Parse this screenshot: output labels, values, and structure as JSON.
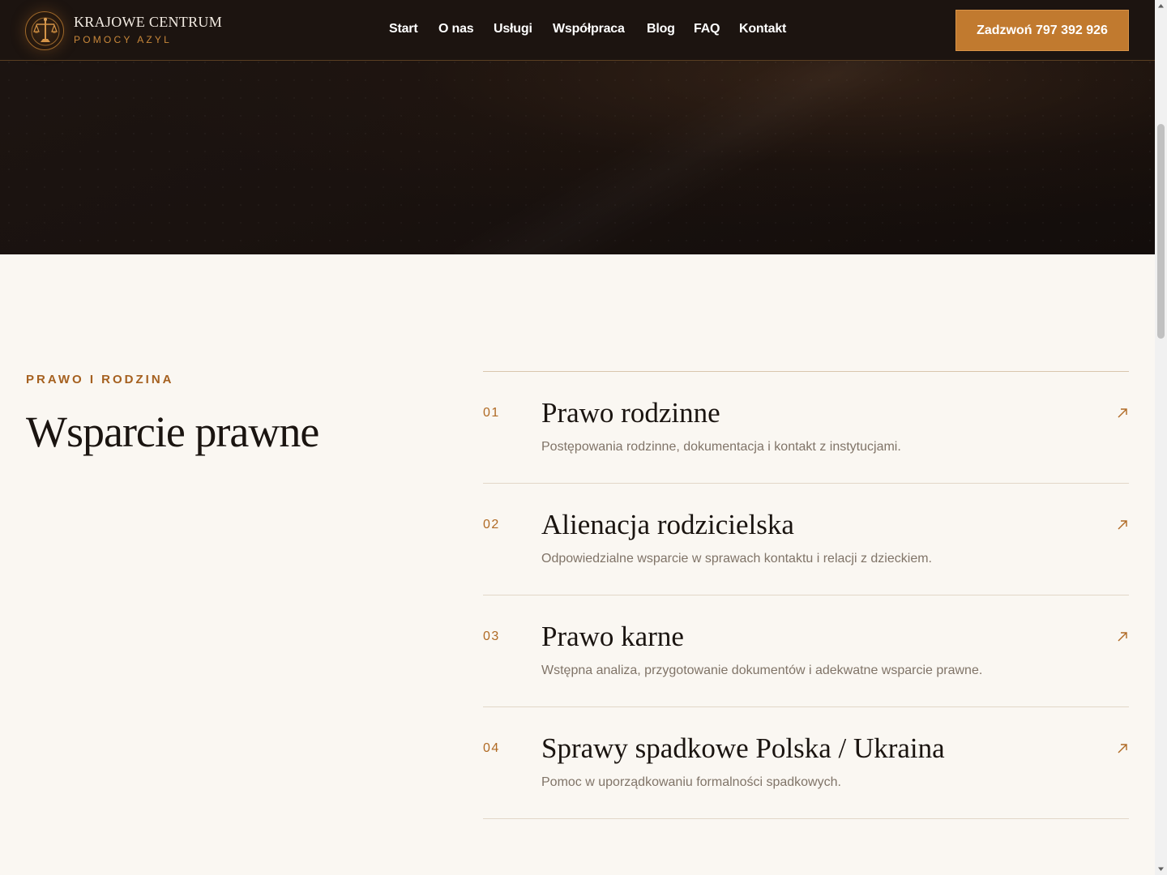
{
  "brand": {
    "title": "KRAJOWE CENTRUM",
    "subtitle": "POMOCY AZYL",
    "logo_icon": "scales-of-justice-emblem-icon",
    "accent_color": "#c17a2f"
  },
  "nav": {
    "items": [
      {
        "label": "Start"
      },
      {
        "label": "O nas"
      },
      {
        "label": "Usługi"
      },
      {
        "label": "Współpraca"
      },
      {
        "label": "Blog"
      },
      {
        "label": "FAQ"
      },
      {
        "label": "Kontakt"
      }
    ]
  },
  "cta": {
    "label": "Zadzwoń 797 392 926"
  },
  "section": {
    "eyebrow": "PRAWO I RODZINA",
    "title": "Wsparcie prawne",
    "items": [
      {
        "number": "01",
        "title": "Prawo rodzinne",
        "description": "Postępowania rodzinne, dokumentacja i kontakt z instytucjami.",
        "icon": "arrow-up-right-icon"
      },
      {
        "number": "02",
        "title": "Alienacja rodzicielska",
        "description": "Odpowiedzialne wsparcie w sprawach kontaktu i relacji z dzieckiem.",
        "icon": "arrow-up-right-icon"
      },
      {
        "number": "03",
        "title": "Prawo karne",
        "description": "Wstępna analiza, przygotowanie dokumentów i adekwatne wsparcie prawne.",
        "icon": "arrow-up-right-icon"
      },
      {
        "number": "04",
        "title": "Sprawy spadkowe Polska / Ukraina",
        "description": "Pomoc w uporządkowaniu formalności spadkowych.",
        "icon": "arrow-up-right-icon"
      }
    ]
  },
  "colors": {
    "header_bg": "#1c1410",
    "page_bg": "#faf7f2",
    "accent": "#c17a2f",
    "eyebrow": "#a5601f"
  }
}
